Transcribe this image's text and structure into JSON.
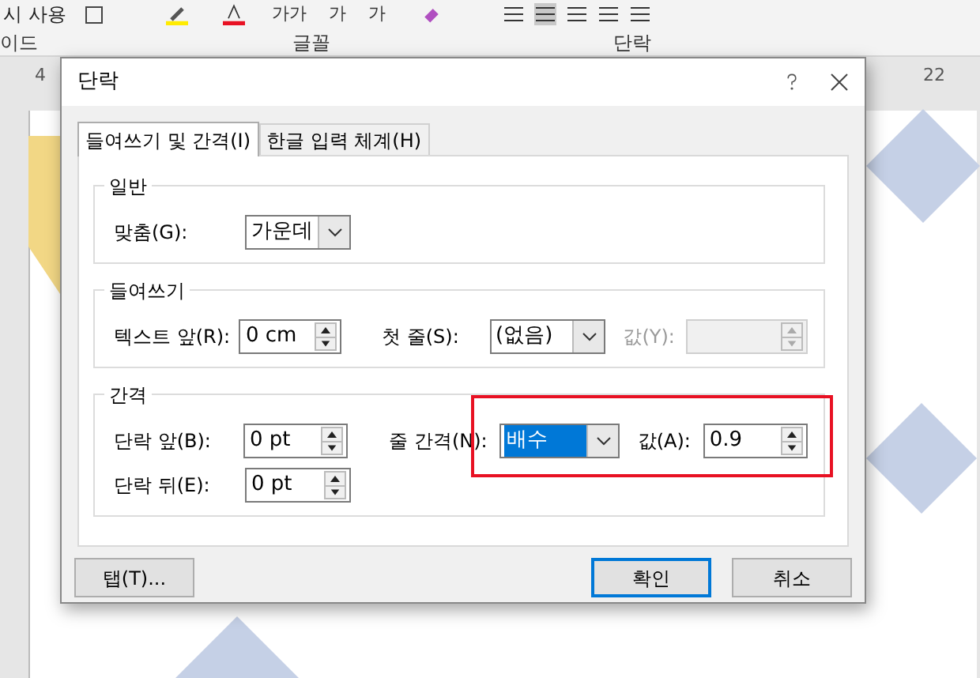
{
  "ribbon": {
    "top_items": [
      {
        "label": "시 사용"
      },
      {
        "label": "가가"
      },
      {
        "label": "가"
      },
      {
        "label": "가"
      }
    ],
    "groups": [
      {
        "label": "이드"
      },
      {
        "label": "글꼴"
      },
      {
        "label": "단락"
      }
    ]
  },
  "ruler": [
    "4",
    "22"
  ],
  "dialog": {
    "title": "단락",
    "tabs": [
      {
        "label": "들여쓰기 및 간격(I)",
        "selected": true
      },
      {
        "label": "한글 입력 체계(H)",
        "selected": false
      }
    ],
    "sections": [
      {
        "title": "일반",
        "rows": [
          [
            {
              "kind": "dropdown",
              "label": "맞춤(G):",
              "value": "가운데",
              "highlighted": false
            }
          ]
        ]
      },
      {
        "title": "들여쓰기",
        "rows": [
          [
            {
              "kind": "spin",
              "label": "텍스트 앞(R):",
              "value": "0 cm",
              "disabled": false
            },
            {
              "kind": "dropdown",
              "label": "첫 줄(S):",
              "value": "(없음)",
              "highlighted": false
            },
            {
              "kind": "spin",
              "label": "값(Y):",
              "disabled": true
            }
          ]
        ]
      },
      {
        "title": "간격",
        "rows": [
          [
            {
              "kind": "spin",
              "label": "단락 앞(B):",
              "value": "0 pt",
              "disabled": false
            },
            {
              "kind": "dropdown",
              "label": "줄 간격(N):",
              "value": "배수",
              "highlighted": true
            },
            {
              "kind": "spin",
              "label": "값(A):",
              "value": "0.9",
              "disabled": false
            }
          ],
          [
            {
              "kind": "spin",
              "label": "단락 뒤(E):",
              "value": "0 pt",
              "disabled": false
            }
          ]
        ]
      }
    ],
    "buttons": [
      {
        "label": "탭(T)...",
        "default": false
      },
      {
        "label": "확인",
        "default": true
      },
      {
        "label": "취소",
        "default": false
      }
    ]
  }
}
